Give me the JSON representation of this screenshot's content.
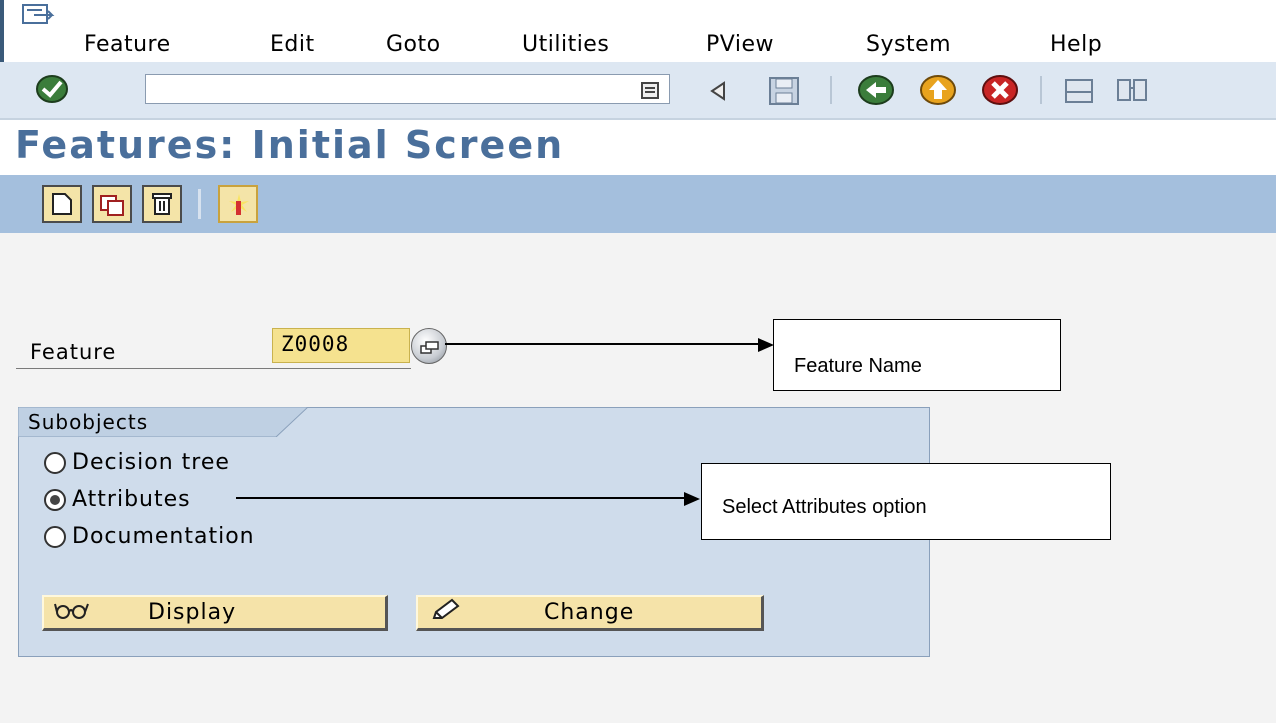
{
  "menubar": {
    "items": [
      {
        "label": "Feature"
      },
      {
        "label": "Edit"
      },
      {
        "label": "Goto"
      },
      {
        "label": "Utilities"
      },
      {
        "label": "PView"
      },
      {
        "label": "System"
      },
      {
        "label": "Help"
      }
    ]
  },
  "toolbar": {
    "command_value": "",
    "icons": [
      "enter-checkmark-icon",
      "command-history-icon",
      "back-triangle-icon",
      "save-icon",
      "back-icon",
      "exit-icon",
      "cancel-icon",
      "print-icon",
      "find-icon"
    ]
  },
  "page": {
    "title": "Features: Initial Screen"
  },
  "app_toolbar": {
    "icons": [
      "create-icon",
      "copy-icon",
      "delete-icon",
      "check-icon"
    ]
  },
  "form": {
    "feature_label": "Feature",
    "feature_value": "Z0008"
  },
  "subobjects": {
    "title": "Subobjects",
    "options": [
      {
        "label": "Decision tree",
        "selected": false
      },
      {
        "label": "Attributes",
        "selected": true
      },
      {
        "label": "Documentation",
        "selected": false
      }
    ],
    "display_label": "Display",
    "change_label": "Change"
  },
  "annotations": {
    "feature_name": "Feature Name",
    "select_attributes": "Select Attributes option"
  },
  "colors": {
    "title": "#4a6f9b",
    "app_toolbar": "#a4bfdd",
    "input_highlight": "#f5e28f",
    "group_box": "#cfdceb"
  }
}
